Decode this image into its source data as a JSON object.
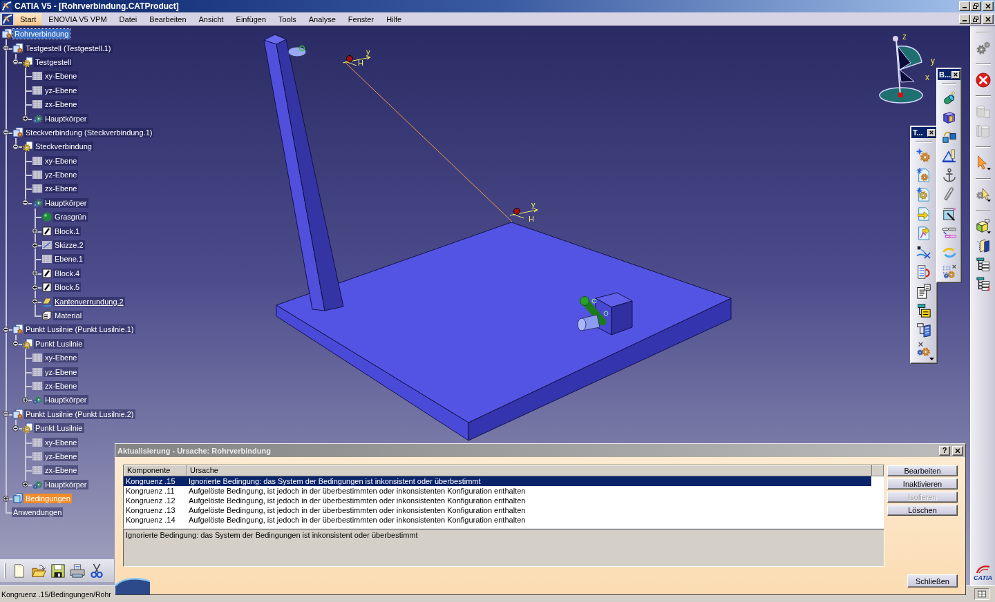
{
  "window": {
    "title": "CATIA V5 - [Rohrverbindung.CATProduct]"
  },
  "menu": [
    {
      "label": "Start",
      "selected": true
    },
    {
      "label": "ENOVIA V5 VPM",
      "selected": false
    },
    {
      "label": "Datei",
      "selected": false
    },
    {
      "label": "Bearbeiten",
      "selected": false
    },
    {
      "label": "Ansicht",
      "selected": false
    },
    {
      "label": "Einfügen",
      "selected": false
    },
    {
      "label": "Tools",
      "selected": false
    },
    {
      "label": "Analyse",
      "selected": false
    },
    {
      "label": "Fenster",
      "selected": false
    },
    {
      "label": "Hilfe",
      "selected": false
    }
  ],
  "tree": [
    {
      "label": "Rohrverbindung",
      "kind": "product",
      "selected": true,
      "flagged": false,
      "underlined": false,
      "children": [
        {
          "label": "Testgestell (Testgestell.1)",
          "kind": "product",
          "expanded": true,
          "selected": false,
          "flagged": false,
          "underlined": false,
          "children": [
            {
              "label": "Testgestell",
              "kind": "part",
              "expanded": true,
              "selected": false,
              "flagged": false,
              "underlined": false,
              "children": [
                {
                  "label": "xy-Ebene",
                  "kind": "plane",
                  "selected": false,
                  "flagged": false,
                  "underlined": false
                },
                {
                  "label": "yz-Ebene",
                  "kind": "plane",
                  "selected": false,
                  "flagged": false,
                  "underlined": false
                },
                {
                  "label": "zx-Ebene",
                  "kind": "plane",
                  "selected": false,
                  "flagged": false,
                  "underlined": false
                },
                {
                  "label": "Hauptkörper",
                  "kind": "body",
                  "expanded": false,
                  "selected": false,
                  "flagged": false,
                  "underlined": false
                }
              ]
            }
          ]
        },
        {
          "label": "Steckverbindung (Steckverbindung.1)",
          "kind": "product",
          "expanded": true,
          "selected": false,
          "flagged": false,
          "underlined": false,
          "children": [
            {
              "label": "Steckverbindung",
              "kind": "part",
              "expanded": true,
              "selected": false,
              "flagged": false,
              "underlined": false,
              "children": [
                {
                  "label": "xy-Ebene",
                  "kind": "plane",
                  "selected": false,
                  "flagged": false,
                  "underlined": false
                },
                {
                  "label": "yz-Ebene",
                  "kind": "plane",
                  "selected": false,
                  "flagged": false,
                  "underlined": false
                },
                {
                  "label": "zx-Ebene",
                  "kind": "plane",
                  "selected": false,
                  "flagged": false,
                  "underlined": false
                },
                {
                  "label": "Hauptkörper",
                  "kind": "body",
                  "expanded": true,
                  "selected": false,
                  "flagged": false,
                  "underlined": false,
                  "children": [
                    {
                      "label": "Grasgrün",
                      "kind": "color",
                      "selected": false,
                      "flagged": false,
                      "underlined": false
                    },
                    {
                      "label": "Block.1",
                      "kind": "feature",
                      "expanded": false,
                      "selected": false,
                      "flagged": false,
                      "underlined": false
                    },
                    {
                      "label": "Skizze.2",
                      "kind": "sketch",
                      "expanded": false,
                      "selected": false,
                      "flagged": false,
                      "underlined": false
                    },
                    {
                      "label": "Ebene.1",
                      "kind": "plane",
                      "selected": false,
                      "flagged": false,
                      "underlined": false
                    },
                    {
                      "label": "Block.4",
                      "kind": "feature",
                      "expanded": false,
                      "selected": false,
                      "flagged": false,
                      "underlined": false
                    },
                    {
                      "label": "Block.5",
                      "kind": "feature",
                      "expanded": false,
                      "selected": false,
                      "flagged": false,
                      "underlined": false
                    },
                    {
                      "label": "Kantenverrundung.2",
                      "kind": "fillet",
                      "expanded": false,
                      "selected": false,
                      "flagged": false,
                      "underlined": true
                    },
                    {
                      "label": "Material",
                      "kind": "material",
                      "selected": false,
                      "flagged": false,
                      "underlined": false
                    }
                  ]
                }
              ]
            }
          ]
        },
        {
          "label": "Punkt Lusilnie (Punkt Lusilnie.1)",
          "kind": "product",
          "expanded": true,
          "selected": false,
          "flagged": false,
          "underlined": false,
          "children": [
            {
              "label": "Punkt Lusilnie",
              "kind": "part",
              "expanded": true,
              "selected": false,
              "flagged": false,
              "underlined": false,
              "children": [
                {
                  "label": "xy-Ebene",
                  "kind": "plane",
                  "selected": false,
                  "flagged": false,
                  "underlined": false
                },
                {
                  "label": "yz-Ebene",
                  "kind": "plane",
                  "selected": false,
                  "flagged": false,
                  "underlined": false
                },
                {
                  "label": "zx-Ebene",
                  "kind": "plane",
                  "selected": false,
                  "flagged": false,
                  "underlined": false
                },
                {
                  "label": "Hauptkörper",
                  "kind": "body",
                  "expanded": false,
                  "selected": false,
                  "flagged": false,
                  "underlined": false
                }
              ]
            }
          ]
        },
        {
          "label": "Punkt Lusilnie (Punkt Lusilnie.2)",
          "kind": "product",
          "expanded": true,
          "selected": false,
          "flagged": false,
          "underlined": false,
          "children": [
            {
              "label": "Punkt Lusilnie",
              "kind": "part",
              "expanded": true,
              "selected": false,
              "flagged": false,
              "underlined": false,
              "children": [
                {
                  "label": "xy-Ebene",
                  "kind": "plane",
                  "selected": false,
                  "flagged": false,
                  "underlined": false
                },
                {
                  "label": "yz-Ebene",
                  "kind": "plane",
                  "selected": false,
                  "flagged": false,
                  "underlined": false
                },
                {
                  "label": "zx-Ebene",
                  "kind": "plane",
                  "selected": false,
                  "flagged": false,
                  "underlined": false
                },
                {
                  "label": "Hauptkörper",
                  "kind": "body",
                  "expanded": false,
                  "selected": false,
                  "flagged": false,
                  "underlined": false
                }
              ]
            }
          ]
        },
        {
          "label": "Bedingungen",
          "kind": "constraints",
          "expanded": false,
          "selected": false,
          "flagged": true,
          "underlined": false
        },
        {
          "label": "Anwendungen",
          "kind": "applications",
          "selected": false,
          "flagged": false,
          "underlined": false
        }
      ]
    }
  ],
  "viewport": {
    "markers": [
      {
        "labels": [
          "y",
          "H"
        ]
      },
      {
        "labels": [
          "y",
          "H"
        ]
      }
    ],
    "compass": {
      "labels": [
        "z",
        "y",
        "x"
      ]
    }
  },
  "floating_toolbars": [
    {
      "title": "B..."
    },
    {
      "title": "T..."
    }
  ],
  "logo": {
    "text": "CATIA"
  },
  "dialog": {
    "title": "Aktualisierung - Ursache: Rohrverbindung",
    "help": "?",
    "columns": [
      "Komponente",
      "Ursache"
    ],
    "rows": [
      {
        "cells": [
          "Kongruenz .15",
          "Ignorierte Bedingung: das System der Bedingungen ist inkonsistent oder überbestimmt"
        ],
        "selected": true
      },
      {
        "cells": [
          "Kongruenz .11",
          "Aufgelöste Bedingung, ist jedoch in der überbestimmten oder inkonsistenten Konfiguration enthalten"
        ],
        "selected": false
      },
      {
        "cells": [
          "Kongruenz .12",
          "Aufgelöste Bedingung, ist jedoch in der überbestimmten oder inkonsistenten Konfiguration enthalten"
        ],
        "selected": false
      },
      {
        "cells": [
          "Kongruenz .13",
          "Aufgelöste Bedingung, ist jedoch in der überbestimmten oder inkonsistenten Konfiguration enthalten"
        ],
        "selected": false
      },
      {
        "cells": [
          "Kongruenz .14",
          "Aufgelöste Bedingung, ist jedoch in der überbestimmten oder inkonsistenten Konfiguration enthalten"
        ],
        "selected": false
      }
    ],
    "description": "Ignorierte Bedingung: das System der Bedingungen ist inkonsistent oder überbestimmt",
    "buttons": [
      {
        "label": "Bearbeiten",
        "disabled": false
      },
      {
        "label": "Inaktivieren",
        "disabled": false
      },
      {
        "label": "Isolieren",
        "disabled": true
      },
      {
        "label": "Löschen",
        "disabled": false
      }
    ],
    "close_button": {
      "label": "Schließen"
    }
  },
  "status_bar": {
    "text": "Kongruenz .15/Bedingungen/Rohr"
  }
}
